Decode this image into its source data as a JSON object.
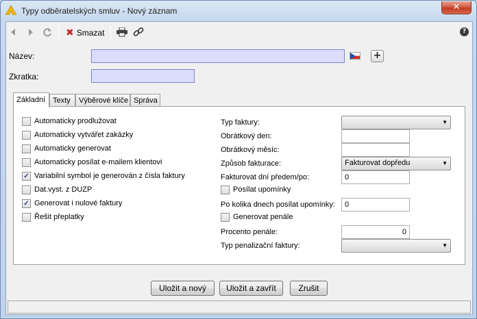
{
  "window": {
    "title": "Typy odběratelských smluv - Nový záznam",
    "close_glyph": "✕"
  },
  "toolbar": {
    "back_icon": "back-arrow-icon",
    "forward_icon": "forward-arrow-icon",
    "refresh_icon": "refresh-icon",
    "delete_label": "Smazat",
    "help_glyph": "?"
  },
  "form": {
    "nazev_label": "Název:",
    "nazev_value": "",
    "zkratka_label": "Zkratka:",
    "zkratka_value": "",
    "add_glyph": "+"
  },
  "tabs": [
    {
      "label": "Základní",
      "active": true
    },
    {
      "label": "Texty",
      "active": false
    },
    {
      "label": "Výběrové klíče",
      "active": false
    },
    {
      "label": "Správa",
      "active": false
    }
  ],
  "checkboxes": [
    {
      "label": "Automaticky prodlužovat",
      "checked": false
    },
    {
      "label": "Automaticky vytvářet zakázky",
      "checked": false
    },
    {
      "label": "Automaticky generovat",
      "checked": false
    },
    {
      "label": "Automaticky posílat e-mailem klientovi",
      "checked": false
    },
    {
      "label": "Variabilní symbol je generován z čísla faktury",
      "checked": true
    },
    {
      "label": "Dat.vyst. z DUZP",
      "checked": false
    },
    {
      "label": "Generovat i nulové faktury",
      "checked": true
    },
    {
      "label": "Řešit přeplatky",
      "checked": false
    }
  ],
  "fields": {
    "typ_faktury_label": "Typ faktury:",
    "typ_faktury_value": "",
    "obratkovy_den_label": "Obrátkový den:",
    "obratkovy_den_value": "",
    "obratkovy_mesic_label": "Obrátkový měsíc:",
    "obratkovy_mesic_value": "",
    "zpusob_fakturace_label": "Způsob fakturace:",
    "zpusob_fakturace_value": "Fakturovat dopředu",
    "fakturovat_dni_label": "Fakturovat dní předem/po:",
    "fakturovat_dni_value": "0",
    "posilat_upominky_label": "Posílat upomínky",
    "po_kolika_label": "Po kolika dnech posílat upomínky:",
    "po_kolika_value": "0",
    "generovat_penale_label": "Generovat penále",
    "procento_penale_label": "Procento penále:",
    "procento_penale_value": "0",
    "typ_penalizacni_label": "Typ penalizační faktury:",
    "typ_penalizacni_value": ""
  },
  "buttons": {
    "save_new": "Uložit a nový",
    "save_close": "Uložit a zavřít",
    "cancel": "Zrušit"
  },
  "colors": {
    "required_field_bg": "#dcdcfc",
    "close_button": "#c94a33",
    "delete_icon": "#c62a1f"
  }
}
